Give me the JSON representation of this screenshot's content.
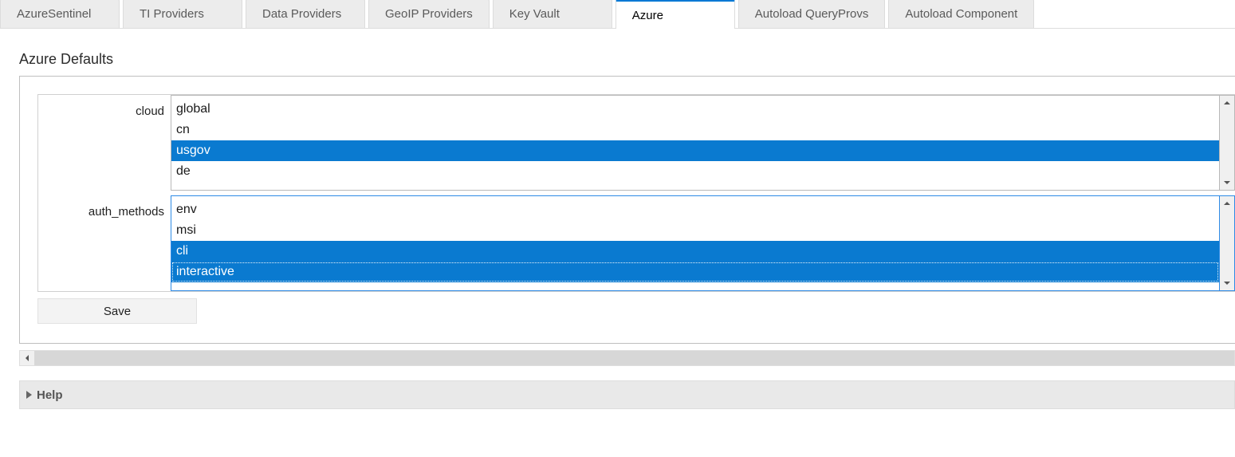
{
  "tabs": [
    {
      "label": "AzureSentinel",
      "active": false
    },
    {
      "label": "TI Providers",
      "active": false
    },
    {
      "label": "Data Providers",
      "active": false
    },
    {
      "label": "GeoIP Providers",
      "active": false
    },
    {
      "label": "Key Vault",
      "active": false
    },
    {
      "label": "Azure",
      "active": true
    },
    {
      "label": "Autoload QueryProvs",
      "active": false
    },
    {
      "label": "Autoload Component",
      "active": false
    }
  ],
  "section_title": "Azure Defaults",
  "fields": {
    "cloud": {
      "label": "cloud",
      "focused": false,
      "options": [
        {
          "value": "global",
          "selected": false,
          "focus": false
        },
        {
          "value": "cn",
          "selected": false,
          "focus": false
        },
        {
          "value": "usgov",
          "selected": true,
          "focus": false
        },
        {
          "value": "de",
          "selected": false,
          "focus": false
        }
      ]
    },
    "auth_methods": {
      "label": "auth_methods",
      "focused": true,
      "options": [
        {
          "value": "env",
          "selected": false,
          "focus": false
        },
        {
          "value": "msi",
          "selected": false,
          "focus": false
        },
        {
          "value": "cli",
          "selected": true,
          "focus": false
        },
        {
          "value": "interactive",
          "selected": true,
          "focus": true
        }
      ]
    }
  },
  "save_label": "Save",
  "help_label": "Help",
  "colors": {
    "selection": "#0a7ad0",
    "tab_active_accent": "#0078d4"
  }
}
